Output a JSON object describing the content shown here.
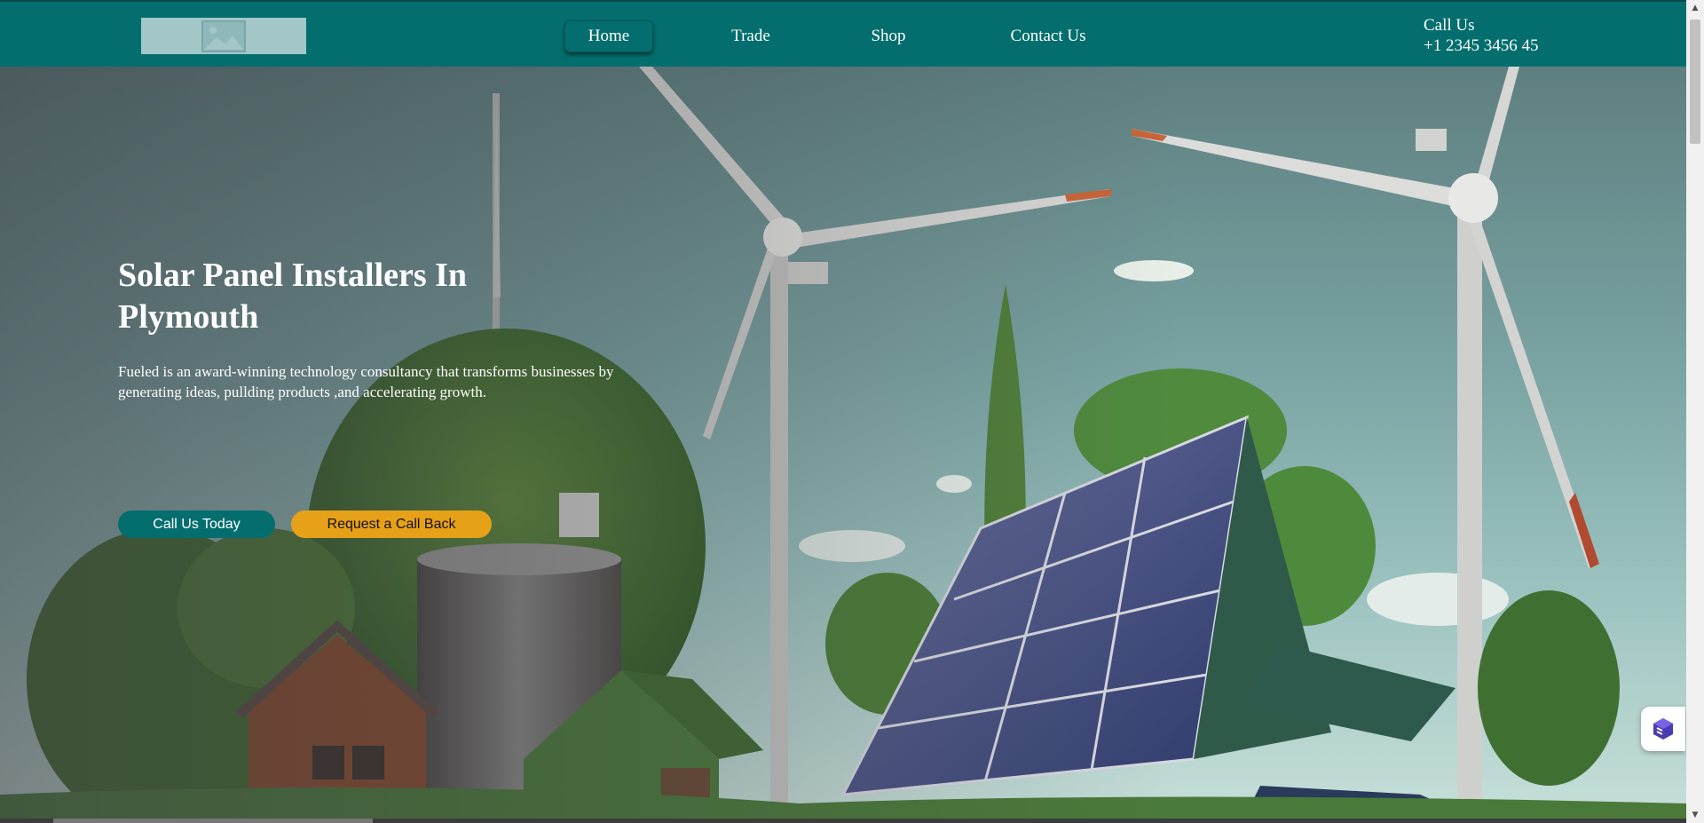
{
  "header": {
    "logo_icon": "image-placeholder-icon",
    "nav": [
      {
        "label": "Home",
        "active": true
      },
      {
        "label": "Trade",
        "active": false
      },
      {
        "label": "Shop",
        "active": false
      },
      {
        "label": "Contact Us",
        "active": false
      }
    ],
    "contact": {
      "label": "Call Us",
      "phone": "+1 2345 3456 45"
    }
  },
  "hero": {
    "title": "Solar Panel Installers In Plymouth",
    "description": "Fueled is an award-winning technology consultancy that transforms businesses by generating ideas, pullding products ,and accelerating growth.",
    "primary_button": "Call Us Today",
    "secondary_button": "Request a Call Back"
  },
  "colors": {
    "brand_teal": "#046e6e",
    "accent_amber": "#e6a119",
    "logo_placeholder": "#a3c6c8"
  },
  "widget": {
    "icon": "layered-cube-icon"
  }
}
